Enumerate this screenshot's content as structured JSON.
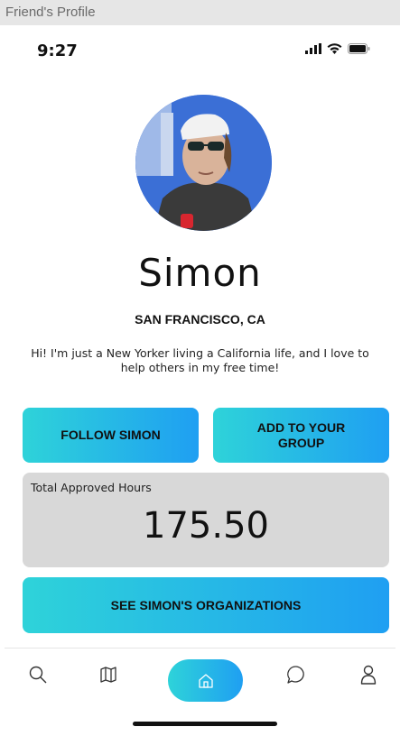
{
  "window": {
    "title": "Friend's Profile"
  },
  "status_bar": {
    "time": "9:27"
  },
  "profile": {
    "name": "Simon",
    "location": "SAN FRANCISCO, CA",
    "bio": "Hi! I'm just a New Yorker living a California life, and I love to help others in my free time!"
  },
  "actions": {
    "follow_label": "FOLLOW SIMON",
    "add_group_label": "ADD TO YOUR GROUP",
    "organizations_label": "SEE SIMON'S ORGANIZATIONS"
  },
  "hours": {
    "label": "Total Approved Hours",
    "value": "175.50"
  },
  "tab_bar": {
    "active": "home",
    "items": [
      "search-icon",
      "map-icon",
      "home-icon",
      "chat-icon",
      "profile-icon"
    ]
  },
  "colors": {
    "gradient_start": "#2ed3d9",
    "gradient_end": "#1f9ff2",
    "card_gray": "#d8d8d8"
  }
}
